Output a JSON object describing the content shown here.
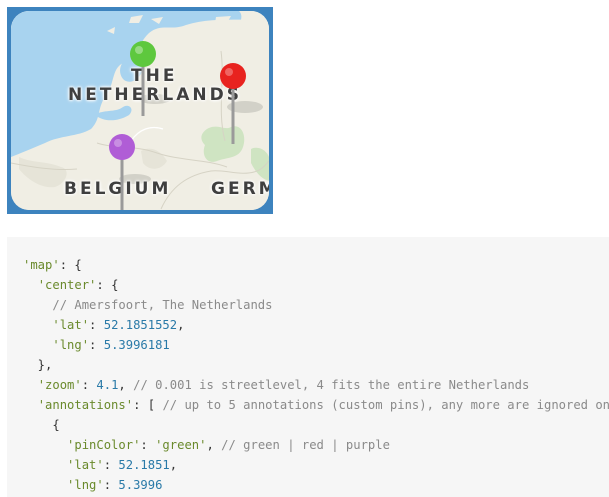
{
  "map": {
    "labels": {
      "netherlands_line1": "THE",
      "netherlands_line2": "NETHERLANDS",
      "belgium": "BELGIUM",
      "germany": "GERM"
    },
    "pins": [
      {
        "name": "green-pin",
        "color": "#5ec83e"
      },
      {
        "name": "red-pin",
        "color": "#e8231f"
      },
      {
        "name": "purple-pin",
        "color": "#b05dd6"
      }
    ],
    "colors": {
      "frame": "#3d83be",
      "water": "#a8d3ef",
      "land": "#f0eee4",
      "forest": "#cfe4c2"
    }
  },
  "code": {
    "lines": [
      [
        {
          "t": "str",
          "v": "'map'"
        },
        {
          "t": "pun",
          "v": ": {"
        }
      ],
      [
        {
          "t": "pun",
          "v": "  "
        },
        {
          "t": "str",
          "v": "'center'"
        },
        {
          "t": "pun",
          "v": ": {"
        }
      ],
      [
        {
          "t": "pun",
          "v": "    "
        },
        {
          "t": "com",
          "v": "// Amersfoort, The Netherlands"
        }
      ],
      [
        {
          "t": "pun",
          "v": "    "
        },
        {
          "t": "str",
          "v": "'lat'"
        },
        {
          "t": "pun",
          "v": ": "
        },
        {
          "t": "num",
          "v": "52.1851552"
        },
        {
          "t": "pun",
          "v": ","
        }
      ],
      [
        {
          "t": "pun",
          "v": "    "
        },
        {
          "t": "str",
          "v": "'lng'"
        },
        {
          "t": "pun",
          "v": ": "
        },
        {
          "t": "num",
          "v": "5.3996181"
        }
      ],
      [
        {
          "t": "pun",
          "v": "  },"
        }
      ],
      [
        {
          "t": "pun",
          "v": "  "
        },
        {
          "t": "str",
          "v": "'zoom'"
        },
        {
          "t": "pun",
          "v": ": "
        },
        {
          "t": "num",
          "v": "4.1"
        },
        {
          "t": "pun",
          "v": ", "
        },
        {
          "t": "com",
          "v": "// 0.001 is streetlevel, 4 fits the entire Netherlands"
        }
      ],
      [
        {
          "t": "pun",
          "v": "  "
        },
        {
          "t": "str",
          "v": "'annotations'"
        },
        {
          "t": "pun",
          "v": ": [ "
        },
        {
          "t": "com",
          "v": "// up to 5 annotations (custom pins), any more are ignored on"
        }
      ],
      [
        {
          "t": "pun",
          "v": "    {"
        }
      ],
      [
        {
          "t": "pun",
          "v": "      "
        },
        {
          "t": "str",
          "v": "'pinColor'"
        },
        {
          "t": "pun",
          "v": ": "
        },
        {
          "t": "str",
          "v": "'green'"
        },
        {
          "t": "pun",
          "v": ", "
        },
        {
          "t": "com",
          "v": "// green | red | purple"
        }
      ],
      [
        {
          "t": "pun",
          "v": "      "
        },
        {
          "t": "str",
          "v": "'lat'"
        },
        {
          "t": "pun",
          "v": ": "
        },
        {
          "t": "num",
          "v": "52.1851"
        },
        {
          "t": "pun",
          "v": ","
        }
      ],
      [
        {
          "t": "pun",
          "v": "      "
        },
        {
          "t": "str",
          "v": "'lng'"
        },
        {
          "t": "pun",
          "v": ": "
        },
        {
          "t": "num",
          "v": "5.3996"
        }
      ]
    ]
  }
}
